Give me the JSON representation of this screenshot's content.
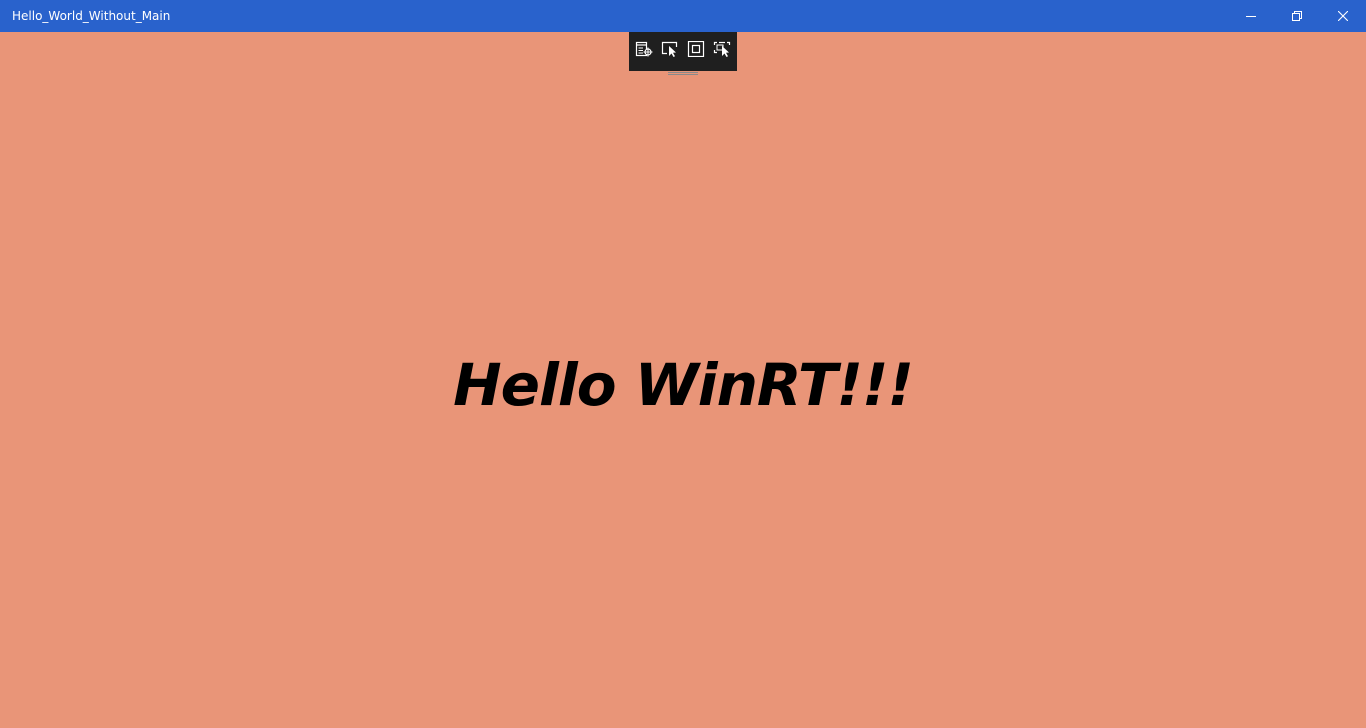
{
  "window": {
    "title": "Hello_World_Without_Main",
    "controls": {
      "minimize_icon": "minimize-icon",
      "maximize_icon": "restore-icon",
      "close_icon": "close-icon"
    },
    "colors": {
      "titlebar": "#2962CC",
      "background": "#E99578",
      "text": "#000000"
    }
  },
  "debug_toolbar": {
    "icons": [
      "live-visual-tree-icon",
      "select-element-icon",
      "display-layout-adorners-icon",
      "track-focused-element-icon"
    ],
    "background": "#1F1F1F"
  },
  "main": {
    "message": "Hello WinRT!!!"
  }
}
